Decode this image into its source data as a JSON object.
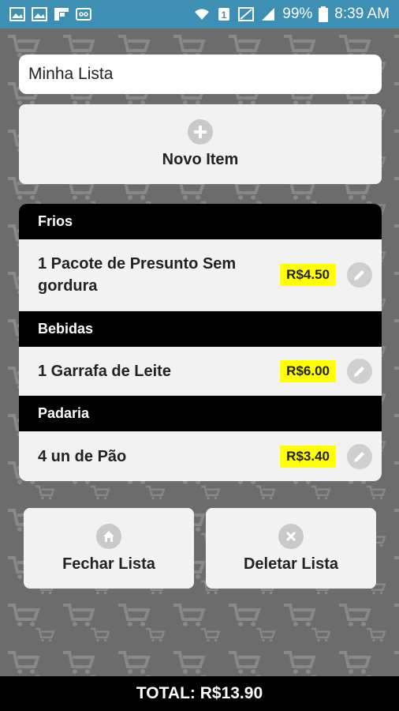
{
  "status_bar": {
    "battery": "99%",
    "time": "8:39 AM"
  },
  "list_name": {
    "value": "Minha Lista"
  },
  "new_item_button": {
    "label": "Novo Item"
  },
  "categories": [
    {
      "name": "Frios",
      "items": [
        {
          "text": "1 Pacote de Presunto Sem gordura",
          "price": "R$4.50"
        }
      ]
    },
    {
      "name": "Bebidas",
      "items": [
        {
          "text": "1 Garrafa de Leite",
          "price": "R$6.00"
        }
      ]
    },
    {
      "name": "Padaria",
      "items": [
        {
          "text": "4 un de Pão",
          "price": "R$3.40"
        }
      ]
    }
  ],
  "actions": {
    "close_label": "Fechar Lista",
    "delete_label": "Deletar Lista"
  },
  "total": {
    "label": "TOTAL: R$13.90"
  },
  "colors": {
    "status_bar": "#3d8fb4",
    "background": "#6c6c6c",
    "price_badge": "#ffff00",
    "category_header": "#000000"
  }
}
